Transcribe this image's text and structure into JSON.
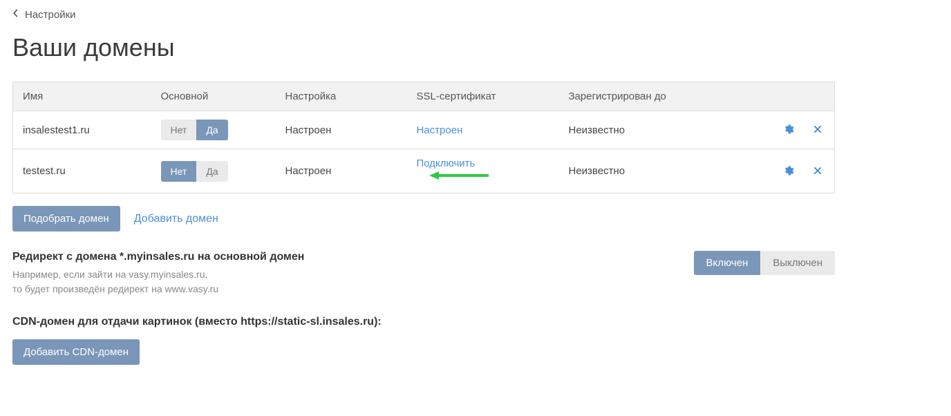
{
  "breadcrumb": {
    "back_label": "Настройки"
  },
  "page_title": "Ваши домены",
  "table": {
    "headers": {
      "name": "Имя",
      "primary": "Основной",
      "config": "Настройка",
      "ssl": "SSL-сертификат",
      "registered": "Зарегистрирован до"
    },
    "toggle_labels": {
      "no": "Нет",
      "yes": "Да"
    },
    "rows": [
      {
        "name": "insalestest1.ru",
        "primary_active": "yes",
        "config": "Настроен",
        "ssl": "Настроен",
        "ssl_action": "link",
        "registered": "Неизвестно"
      },
      {
        "name": "testest.ru",
        "primary_active": "no",
        "config": "Настроен",
        "ssl": "Подключить",
        "ssl_action": "connect",
        "registered": "Неизвестно"
      }
    ]
  },
  "actions": {
    "pick_domain": "Подобрать домен",
    "add_domain": "Добавить домен"
  },
  "redirect_section": {
    "title": "Редирект с домена *.myinsales.ru на основной домен",
    "hint_line1": "Например, если зайти на vasy.myinsales.ru,",
    "hint_line2": "то будет произведён редирект на www.vasy.ru",
    "toggle_on": "Включен",
    "toggle_off": "Выключен",
    "active": "on"
  },
  "cdn_section": {
    "title": "CDN-домен для отдачи картинок (вместо https://static-sl.insales.ru):",
    "button": "Добавить CDN-домен"
  }
}
